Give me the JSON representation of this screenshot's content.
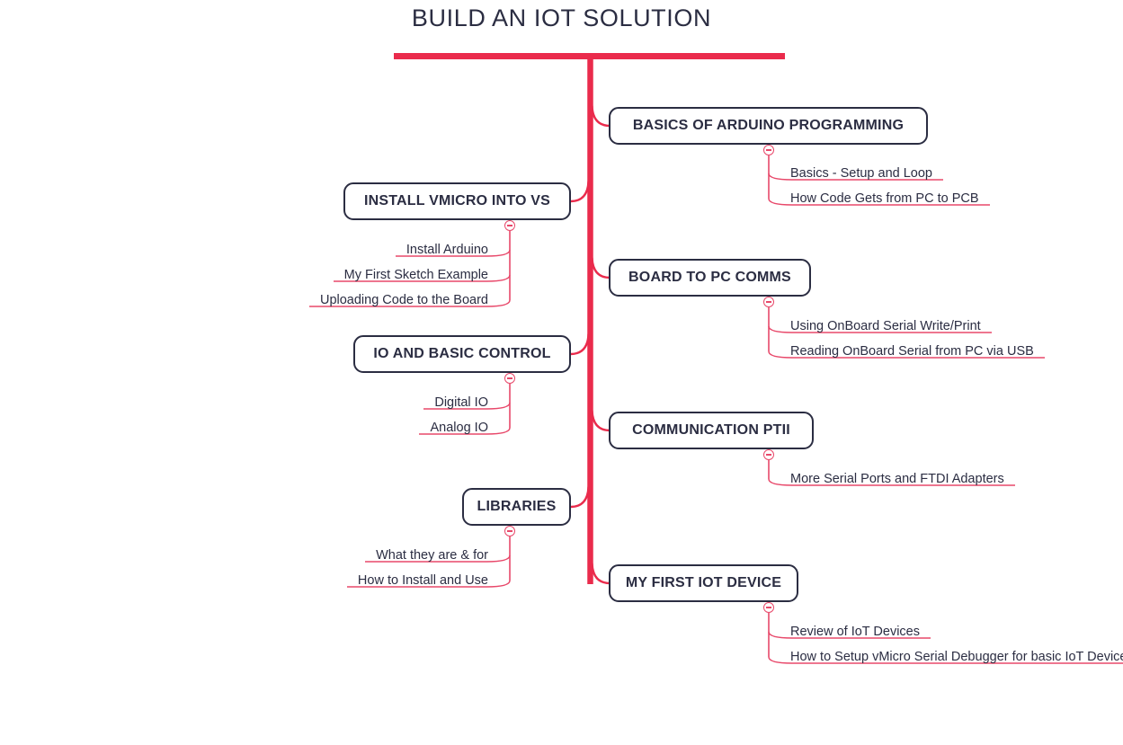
{
  "root": {
    "title": "BUILD AN IOT SOLUTION",
    "bar_color": "#ea2b4c"
  },
  "theme": {
    "trunk_color": "#ea2b4c",
    "branch_color": "#e8486a",
    "node_border_color": "#2b2d42",
    "text_color": "#2b2d42",
    "background": "#ffffff"
  },
  "branches": [
    {
      "id": "basics-of-arduino-programming",
      "label": "BASICS OF ARDUINO PROGRAMMING",
      "side": "right",
      "collapse_icon": "minus-circle-icon",
      "children": [
        {
          "label": "Basics - Setup and Loop"
        },
        {
          "label": "How Code Gets from PC to PCB"
        }
      ]
    },
    {
      "id": "install-vmicro-into-vs",
      "label": "INSTALL VMICRO INTO VS",
      "side": "left",
      "collapse_icon": "minus-circle-icon",
      "children": [
        {
          "label": "Install Arduino"
        },
        {
          "label": "My First Sketch Example"
        },
        {
          "label": "Uploading Code to the Board"
        }
      ]
    },
    {
      "id": "board-to-pc-comms",
      "label": "BOARD TO PC COMMS",
      "side": "right",
      "collapse_icon": "minus-circle-icon",
      "children": [
        {
          "label": "Using OnBoard Serial Write/Print"
        },
        {
          "label": "Reading OnBoard Serial from PC via USB"
        }
      ]
    },
    {
      "id": "io-and-basic-control",
      "label": "IO AND BASIC CONTROL",
      "side": "left",
      "collapse_icon": "minus-circle-icon",
      "children": [
        {
          "label": "Digital IO"
        },
        {
          "label": "Analog IO"
        }
      ]
    },
    {
      "id": "communication-ptii",
      "label": "COMMUNICATION PTII",
      "side": "right",
      "collapse_icon": "minus-circle-icon",
      "children": [
        {
          "label": "More Serial Ports and FTDI Adapters"
        }
      ]
    },
    {
      "id": "libraries",
      "label": "LIBRARIES",
      "side": "left",
      "collapse_icon": "minus-circle-icon",
      "children": [
        {
          "label": "What they are & for"
        },
        {
          "label": "How to Install and Use"
        }
      ]
    },
    {
      "id": "my-first-iot-device",
      "label": "MY FIRST IOT DEVICE",
      "side": "right",
      "collapse_icon": "minus-circle-icon",
      "children": [
        {
          "label": "Review of IoT Devices"
        },
        {
          "label": "How to Setup vMicro Serial Debugger for basic IoT Device"
        }
      ]
    }
  ]
}
